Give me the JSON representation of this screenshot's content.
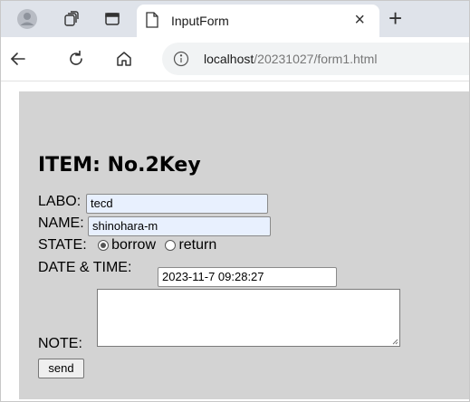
{
  "browser": {
    "tab": {
      "title": "InputForm"
    },
    "new_tab_symbol": "+",
    "close_symbol": "×",
    "address": {
      "host": "localhost",
      "path": "/20231027/form1.html"
    }
  },
  "form": {
    "title": "ITEM: No.2Key",
    "labo": {
      "label": "LABO:",
      "value": "tecd"
    },
    "name": {
      "label": "NAME:",
      "value": "shinohara-m"
    },
    "state": {
      "label": "STATE:",
      "options": [
        {
          "label": "borrow",
          "checked": true
        },
        {
          "label": "return",
          "checked": false
        }
      ]
    },
    "datetime": {
      "label": "DATE & TIME:",
      "value": "2023-11-7 09:28:27"
    },
    "note": {
      "label": "NOTE:",
      "value": ""
    },
    "send_label": "send"
  },
  "colors": {
    "tabbar_bg": "#dfe3ea",
    "form_bg": "#d3d3d3",
    "autofill_bg": "#e8f0fe"
  },
  "icons": [
    "profile-icon",
    "collections-icon",
    "tab-actions-icon",
    "page-icon",
    "close-icon",
    "new-tab-icon",
    "back-arrow-icon",
    "refresh-icon",
    "home-icon",
    "info-icon",
    "resize-grip-icon"
  ]
}
